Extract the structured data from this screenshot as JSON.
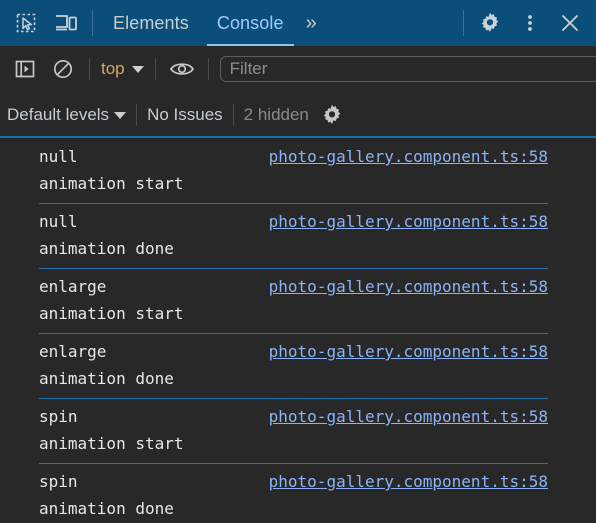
{
  "header": {
    "inspect_icon": "inspect-element-icon",
    "device_icon": "device-toolbar-icon",
    "tabs": [
      {
        "label": "Elements",
        "active": false
      },
      {
        "label": "Console",
        "active": true
      }
    ],
    "more_tabs_label": "»",
    "settings_icon": "gear-icon",
    "menu_icon": "kebab-menu-icon",
    "close_icon": "close-icon"
  },
  "toolbar": {
    "sidebar_toggle_icon": "console-sidebar-toggle-icon",
    "clear_icon": "clear-console-icon",
    "context_label": "top",
    "eye_icon": "live-expression-eye-icon",
    "filter_placeholder": "Filter",
    "filter_value": ""
  },
  "levelbar": {
    "levels_label": "Default levels",
    "issues_label": "No Issues",
    "hidden_label": "2 hidden",
    "settings_icon": "console-settings-gear-icon"
  },
  "console": {
    "source_link": "photo-gallery.component.ts:58",
    "entries": [
      {
        "value": "null",
        "message": "animation start"
      },
      {
        "value": "null",
        "message": "animation done"
      },
      {
        "value": "enlarge",
        "message": "animation start"
      },
      {
        "value": "enlarge",
        "message": "animation done"
      },
      {
        "value": "spin",
        "message": "animation start"
      },
      {
        "value": "spin",
        "message": "animation done"
      }
    ]
  },
  "colors": {
    "header_bg": "#0a4e79",
    "panel_bg": "#282828",
    "accent_blue": "#8ab4f8",
    "rule_blue": "#1a6fa8",
    "context_orange": "#d7a85a"
  }
}
